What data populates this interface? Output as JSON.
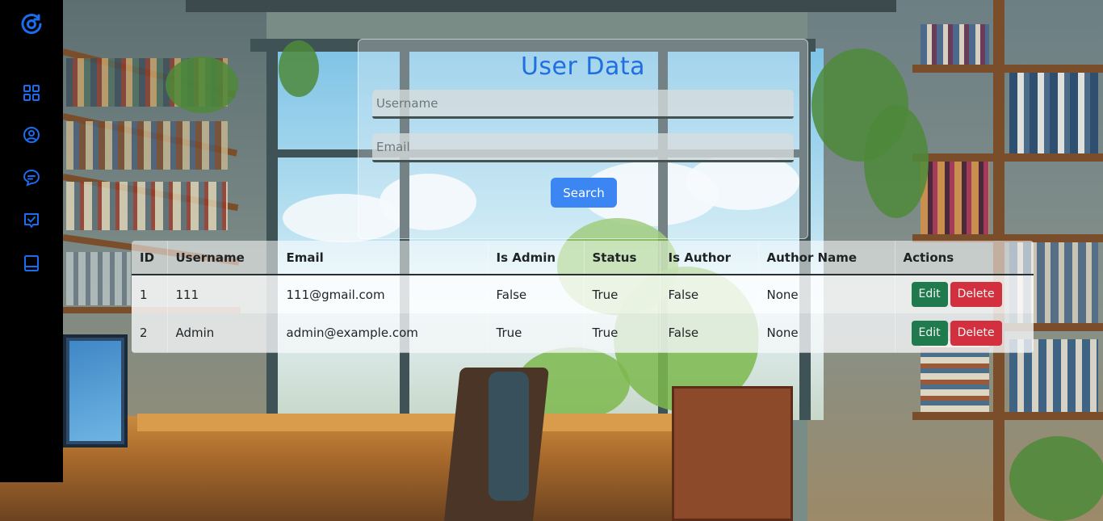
{
  "sidebar": {
    "items": [
      {
        "icon": "grid-icon"
      },
      {
        "icon": "user-circle-icon"
      },
      {
        "icon": "chat-icon"
      },
      {
        "icon": "checklist-icon"
      },
      {
        "icon": "book-icon"
      }
    ],
    "accent": "#1a6cf0"
  },
  "search": {
    "title": "User Data",
    "username_placeholder": "Username",
    "username_value": "",
    "email_placeholder": "Email",
    "email_value": "",
    "button_label": "Search"
  },
  "table": {
    "headers": [
      "ID",
      "Username",
      "Email",
      "Is Admin",
      "Status",
      "Is Author",
      "Author Name",
      "Actions"
    ],
    "rows": [
      {
        "id": "1",
        "username": "111",
        "email": "111@gmail.com",
        "is_admin": "False",
        "status": "True",
        "is_author": "False",
        "author_name": "None"
      },
      {
        "id": "2",
        "username": "Admin",
        "email": "admin@example.com",
        "is_admin": "True",
        "status": "True",
        "is_author": "False",
        "author_name": "None"
      }
    ],
    "edit_label": "Edit",
    "delete_label": "Delete"
  },
  "colors": {
    "title": "#1f6fe0",
    "search_button": "#3b86f2",
    "edit_button": "#1f7a4d",
    "delete_button": "#d2303f"
  }
}
